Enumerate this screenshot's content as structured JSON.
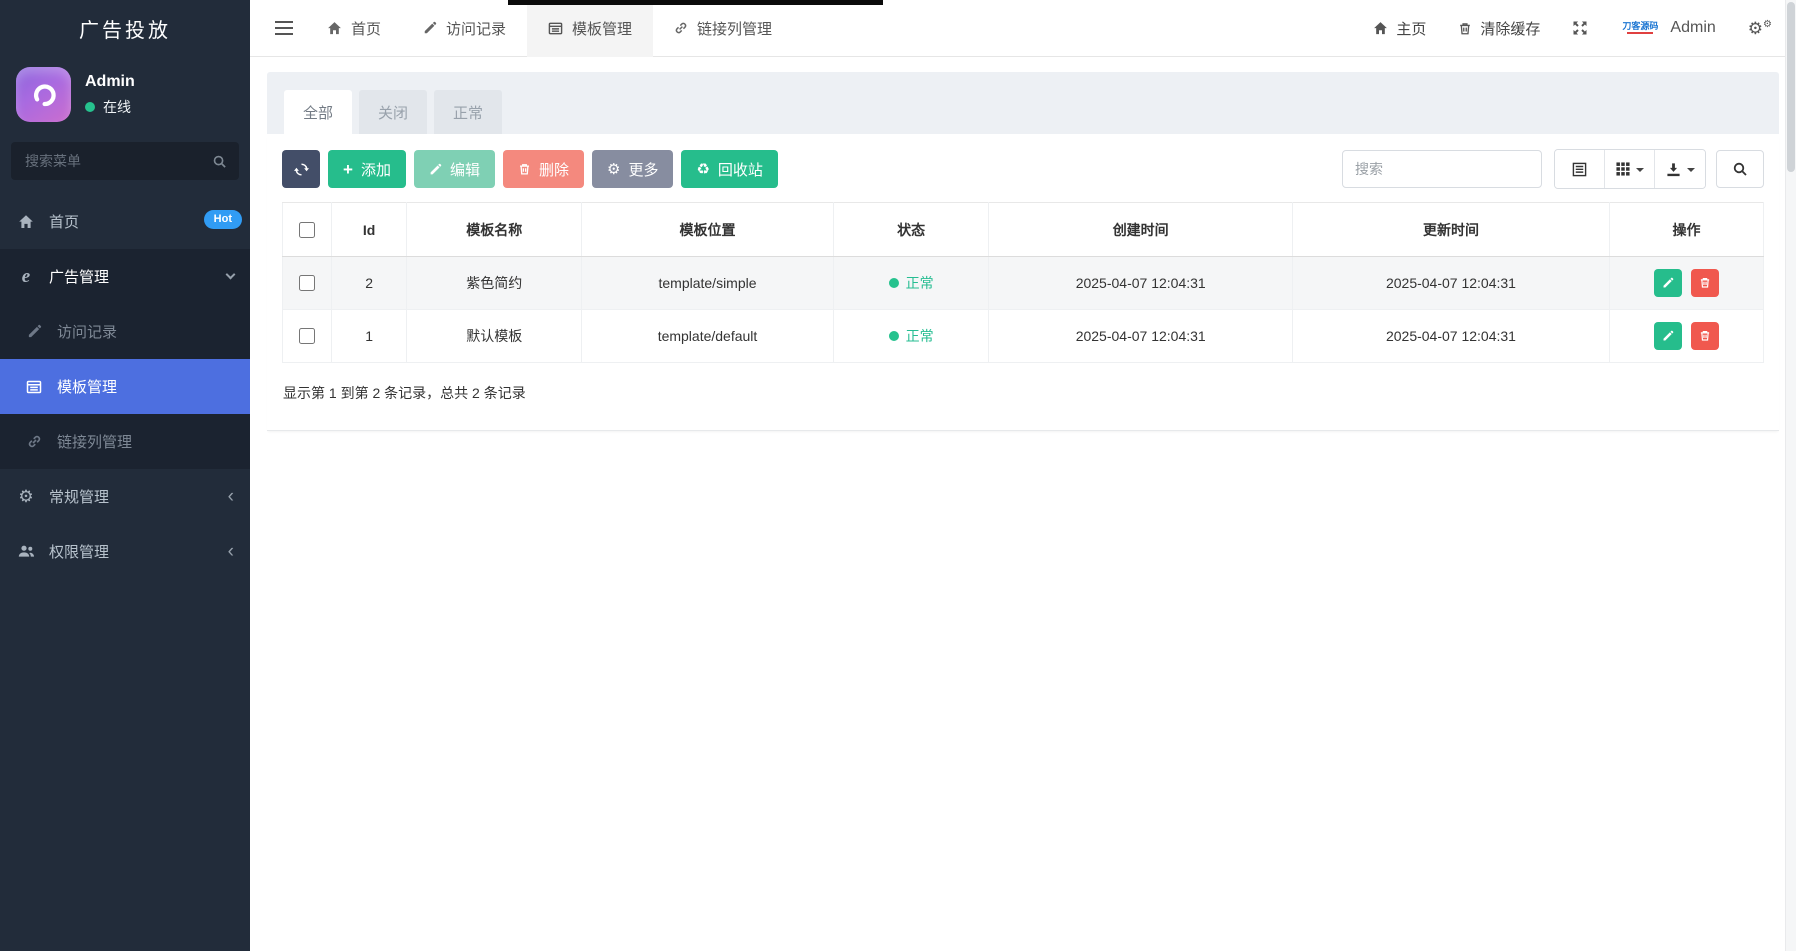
{
  "app": {
    "title": "广告投放"
  },
  "user": {
    "name": "Admin",
    "status_label": "在线"
  },
  "sidebar": {
    "search_placeholder": "搜索菜单",
    "home": {
      "label": "首页",
      "badge": "Hot"
    },
    "ad_section": {
      "label": "广告管理",
      "children": [
        {
          "label": "访问记录"
        },
        {
          "label": "模板管理"
        },
        {
          "label": "链接列管理"
        }
      ]
    },
    "general": {
      "label": "常规管理"
    },
    "permission": {
      "label": "权限管理"
    }
  },
  "topbar": {
    "tabs": [
      {
        "label": "首页"
      },
      {
        "label": "访问记录"
      },
      {
        "label": "模板管理"
      },
      {
        "label": "链接列管理"
      }
    ],
    "home_link": "主页",
    "clear_cache": "清除缓存",
    "logo_text": "刀客源码",
    "username": "Admin"
  },
  "filter_tabs": [
    {
      "label": "全部"
    },
    {
      "label": "关闭"
    },
    {
      "label": "正常"
    }
  ],
  "toolbar": {
    "add_label": "添加",
    "edit_label": "编辑",
    "delete_label": "删除",
    "more_label": "更多",
    "recycle_label": "回收站",
    "search_placeholder": "搜索"
  },
  "table": {
    "columns": [
      "Id",
      "模板名称",
      "模板位置",
      "状态",
      "创建时间",
      "更新时间",
      "操作"
    ],
    "rows": [
      {
        "id": "2",
        "name": "紫色简约",
        "path": "template/simple",
        "status": "正常",
        "created_at": "2025-04-07 12:04:31",
        "updated_at": "2025-04-07 12:04:31"
      },
      {
        "id": "1",
        "name": "默认模板",
        "path": "template/default",
        "status": "正常",
        "created_at": "2025-04-07 12:04:31",
        "updated_at": "2025-04-07 12:04:31"
      }
    ]
  },
  "pagination_summary": "显示第 1 到第 2 条记录，总共 2 条记录",
  "colors": {
    "sidebar_bg": "#222c3a",
    "active_menu": "#4d6fe0",
    "green": "#26bd8c",
    "red": "#f0584e",
    "disabled_green": "#7fd0b4",
    "disabled_red": "#f4897e",
    "dark_button": "#434e68",
    "gray_button": "#878da0",
    "status_green": "#26bd92",
    "badge_blue": "#319cf4"
  }
}
